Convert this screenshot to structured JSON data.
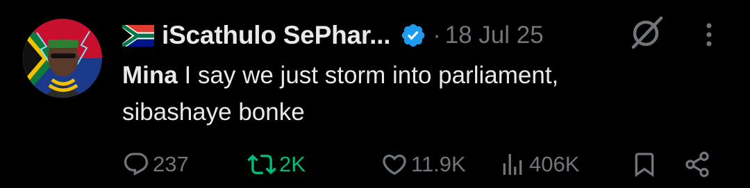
{
  "tweet": {
    "author": {
      "display_name": "iScathulo SePhar...",
      "avatar_icon": "avatar-image",
      "flag_icon": "south-africa-flag-icon",
      "verified_icon": "verified-badge-icon"
    },
    "separator": "·",
    "date": "18 Jul 25",
    "text_mention": "Mina",
    "text_line1_rest": " I say we just storm into parliament,",
    "text_line2": "sibashaye bonke"
  },
  "actions": {
    "reply_count": "237",
    "repost_count": "2K",
    "like_count": "11.9K",
    "view_count": "406K"
  },
  "colors": {
    "background": "#000000",
    "text_primary": "#e7e9ea",
    "text_secondary": "#71767b",
    "repost_active": "#00ba7c",
    "verified": "#1d9bf0"
  }
}
